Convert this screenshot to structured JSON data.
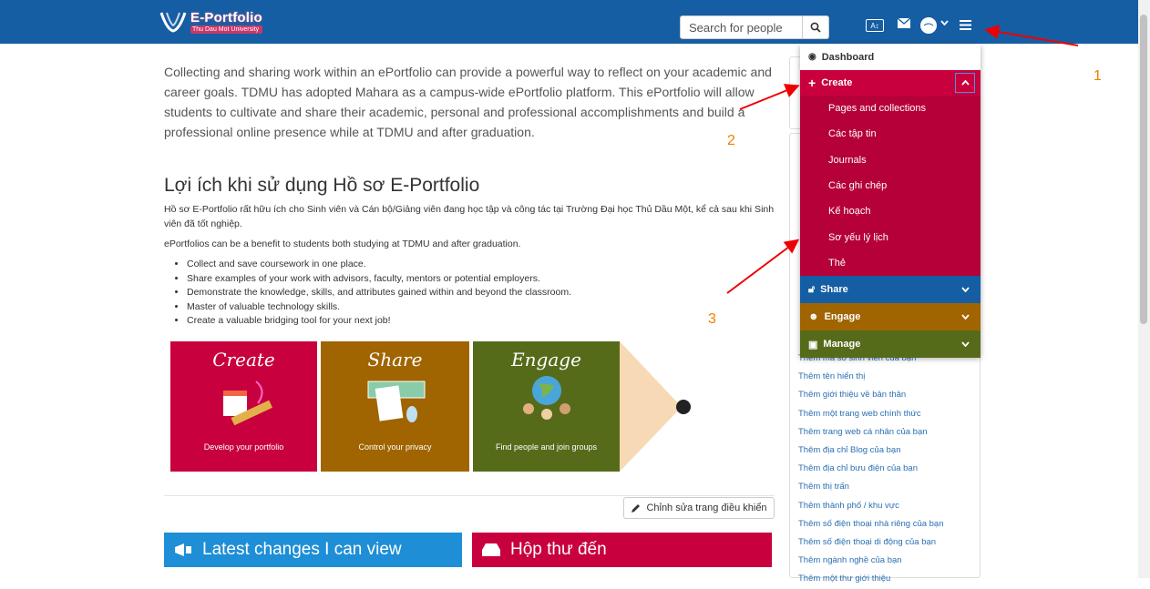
{
  "header": {
    "logo_title": "E-Portfolio",
    "logo_sub": "Thu Dau Mot University",
    "search_placeholder": "Search for people",
    "colors": {
      "bar": "#155ea3"
    }
  },
  "intro": "Collecting and sharing work within an ePortfolio can provide a powerful way to reflect on your academic and career goals.  TDMU has adopted Mahara as a campus-wide ePortfolio platform.  This ePortfolio will allow students to cultivate and share their academic, personal and professional accomplishments and build a professional online presence while at TDMU and after graduation.",
  "benefit_title": "Lợi ích khi sử dụng Hồ sơ E-Portfolio",
  "benefit_p1": "Hồ sơ E-Portfolio rất hữu ích cho Sinh viên và Cán bộ/Giảng viên đang học tập và công tác tại Trường Đại học Thủ Dầu Một, kể cả sau khi Sinh viên đã tốt nghiệp.",
  "benefit_p2": "ePortfolios can be a benefit to students both studying at TDMU and after graduation.",
  "bullets": [
    "Collect and save coursework in one place.",
    "Share examples of your work with advisors, faculty, mentors or potential employers.",
    "Demonstrate the knowledge, skills, and attributes gained within and beyond the classroom.",
    "Master of valuable technology skills.",
    "Create a valuable bridging tool for your next job!"
  ],
  "puzzle": [
    {
      "title": "Create",
      "caption": "Develop your portfolio",
      "color": "#c8003d"
    },
    {
      "title": "Share",
      "caption": "Control your privacy",
      "color": "#a06400"
    },
    {
      "title": "Engage",
      "caption": "Find people and join groups",
      "color": "#566b1a"
    }
  ],
  "edit_dashboard": "Chỉnh sửa trang điều khiển",
  "blocks": {
    "latest": "Latest changes I can view",
    "inbox": "Hộp thư đến"
  },
  "menu": {
    "dashboard": "Dashboard",
    "create": "Create",
    "create_items": [
      "Pages and collections",
      "Các tập tin",
      "Journals",
      "Các ghi chép",
      "Kế hoạch",
      "Sơ yếu lý lịch",
      "Thẻ"
    ],
    "share": "Share",
    "engage": "Engage",
    "manage": "Manage"
  },
  "sidebar_links": [
    "Thêm mã số sinh viên của bạn",
    "Thêm tên hiển thị",
    "Thêm giới thiệu về bản thân",
    "Thêm một trang web chính thức",
    "Thêm trang web cá nhân của bạn",
    "Thêm địa chỉ Blog của bạn",
    "Thêm địa chỉ bưu điện của bạn",
    "Thêm thị trấn",
    "Thêm thành phố / khu vực",
    "Thêm số điện thoại nhà riêng của bạn",
    "Thêm số điện thoại di động của bạn",
    "Thêm ngành nghề của bạn",
    "Thêm một thư giới thiệu"
  ],
  "annotations": [
    "1",
    "2",
    "3"
  ]
}
